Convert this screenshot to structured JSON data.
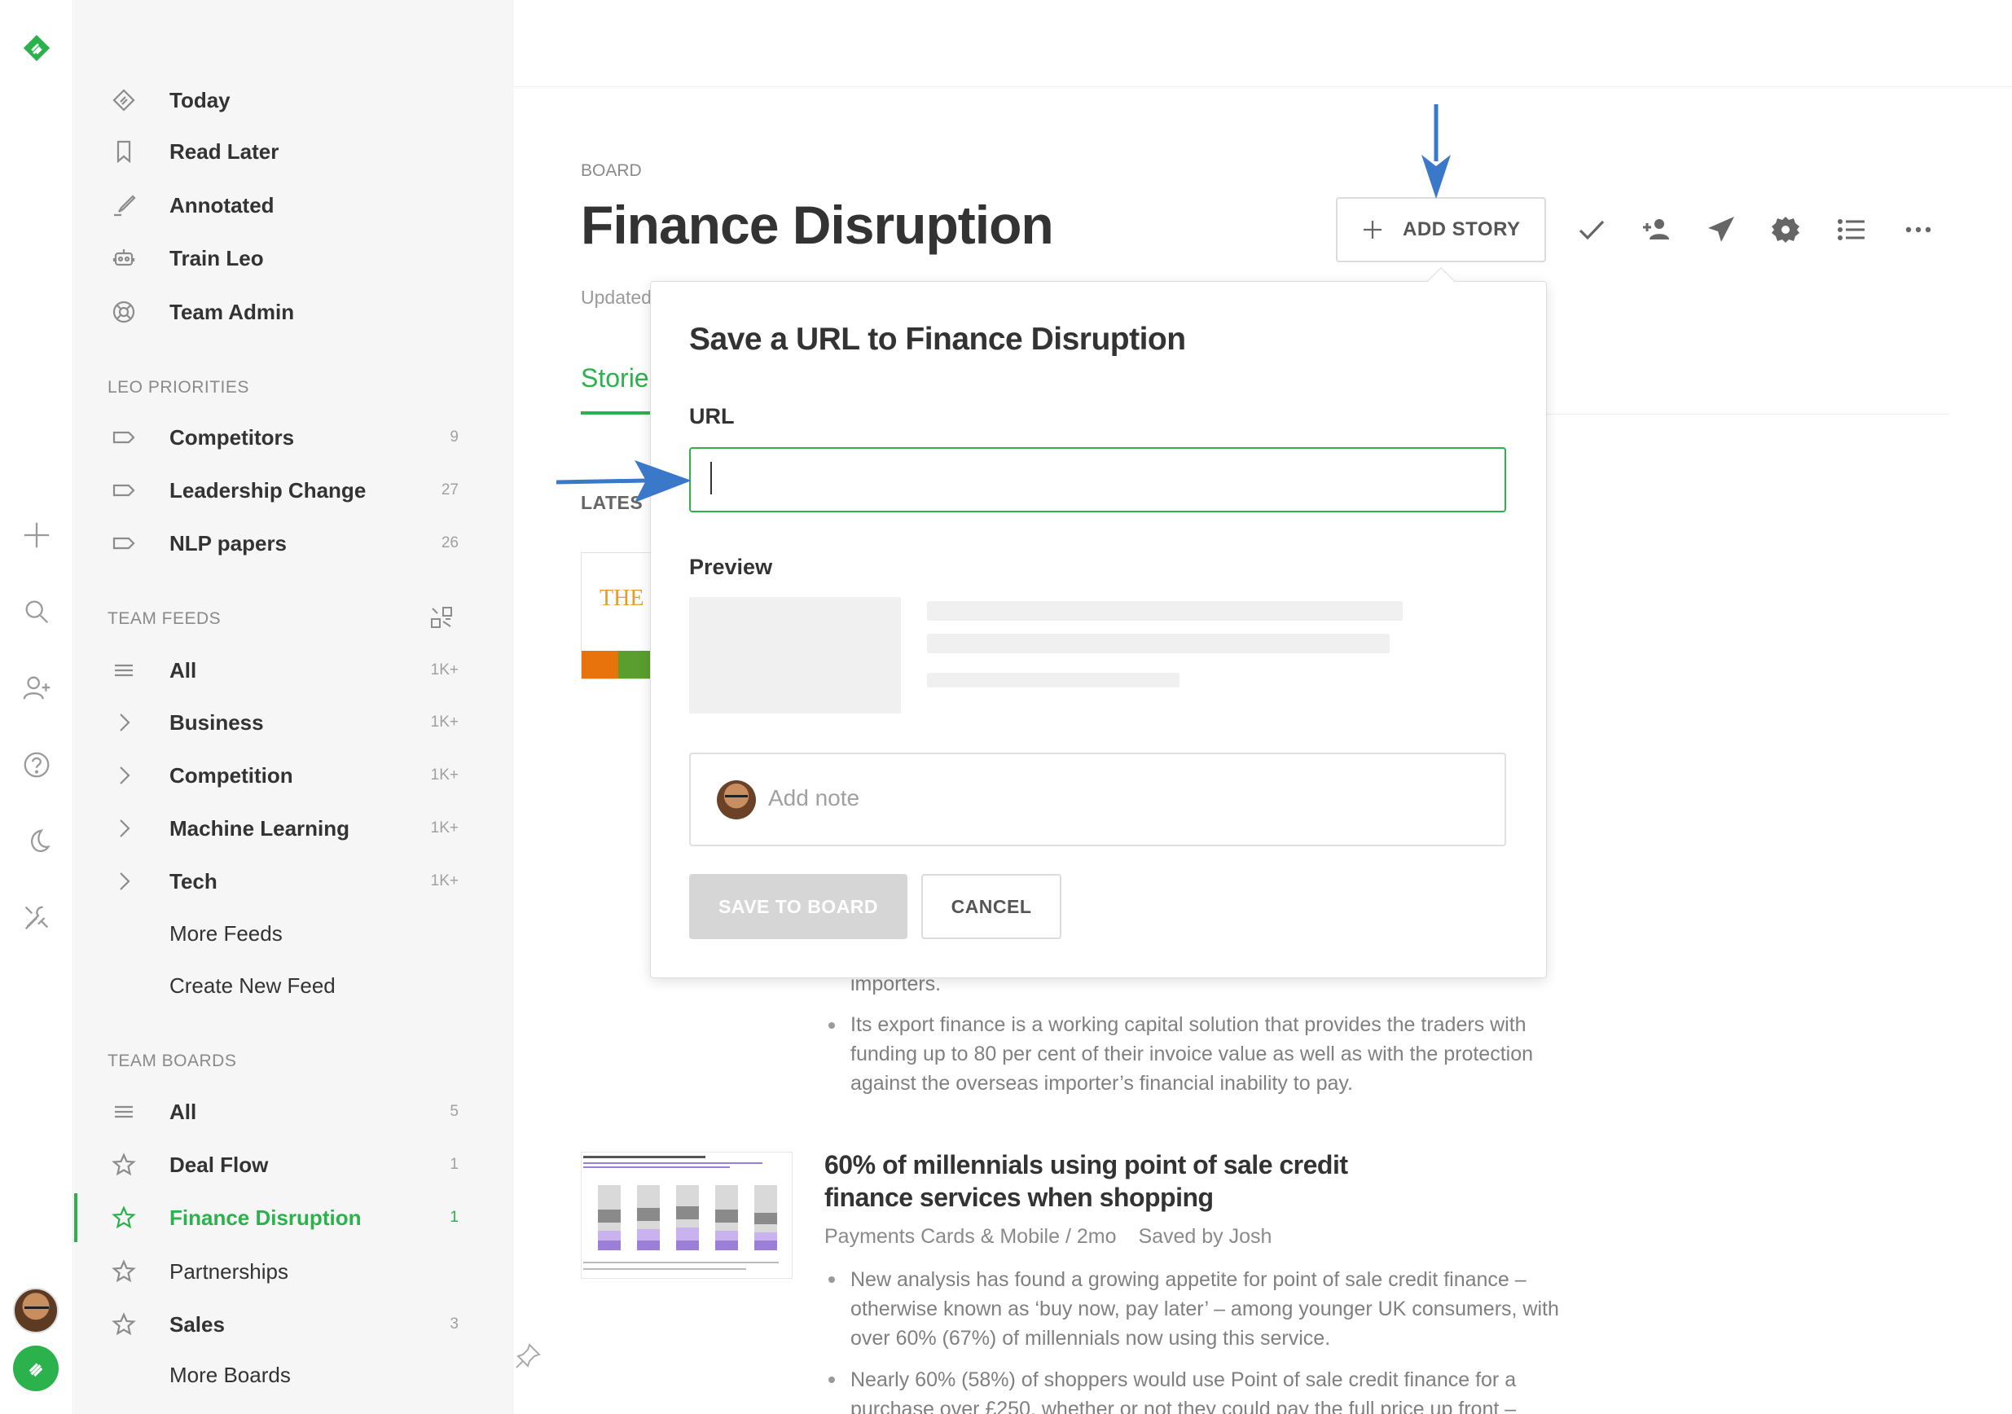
{
  "sidebar": {
    "primary": [
      {
        "label": "Today",
        "icon": "today-icon"
      },
      {
        "label": "Read Later",
        "icon": "bookmark-icon"
      },
      {
        "label": "Annotated",
        "icon": "highlighter-icon"
      },
      {
        "label": "Train Leo",
        "icon": "robot-icon"
      },
      {
        "label": "Team Admin",
        "icon": "lifebuoy-icon"
      }
    ],
    "leo_priorities": {
      "heading": "LEO PRIORITIES",
      "items": [
        {
          "label": "Competitors",
          "count": "9"
        },
        {
          "label": "Leadership Change",
          "count": "27"
        },
        {
          "label": "NLP papers",
          "count": "26"
        }
      ]
    },
    "team_feeds": {
      "heading": "TEAM FEEDS",
      "items": [
        {
          "label": "All",
          "count": "1K+"
        },
        {
          "label": "Business",
          "count": "1K+"
        },
        {
          "label": "Competition",
          "count": "1K+"
        },
        {
          "label": "Machine Learning",
          "count": "1K+"
        },
        {
          "label": "Tech",
          "count": "1K+"
        }
      ],
      "more": "More Feeds",
      "create": "Create New Feed"
    },
    "team_boards": {
      "heading": "TEAM BOARDS",
      "items": [
        {
          "label": "All",
          "count": "5"
        },
        {
          "label": "Deal Flow",
          "count": "1"
        },
        {
          "label": "Finance Disruption",
          "count": "1",
          "active": true
        },
        {
          "label": "Partnerships",
          "count": ""
        },
        {
          "label": "Sales",
          "count": "3"
        }
      ],
      "more": "More Boards"
    }
  },
  "main": {
    "board_label": "BOARD",
    "title": "Finance Disruption",
    "updated_partial": "Updated",
    "tab_partial": "Storie",
    "latest_partial": "LATES",
    "add_story": "ADD STORY",
    "thumb_text": "THE"
  },
  "popup": {
    "title": "Save a URL to Finance Disruption",
    "url_label": "URL",
    "url_value": "",
    "preview_label": "Preview",
    "note_placeholder": "Add note",
    "save_button": "SAVE TO BOARD",
    "cancel_button": "CANCEL"
  },
  "articles": {
    "partial_line": "importers.",
    "first_bullet": "Its export finance is a working capital solution that provides the traders with funding up to 80 per cent of their invoice value as well as with the protection against the overseas importer’s financial inability to pay.",
    "second_title": "60% of millennials using point of sale credit finance services when shopping",
    "second_meta": "Payments Cards & Mobile / 2mo",
    "second_saved": "Saved by Josh",
    "second_bullets": [
      "New analysis has found a growing appetite for point of sale credit finance – otherwise known as ‘buy now, pay later’ – among younger UK consumers, with over 60% (67%) of millennials now using this service.",
      "Nearly 60% (58%) of shoppers would use Point of sale credit finance for a purchase over £250, whether or not they could pay the full price up front –"
    ]
  },
  "colors": {
    "accent": "#2bb24c",
    "annotation_arrow": "#3a78c9"
  }
}
